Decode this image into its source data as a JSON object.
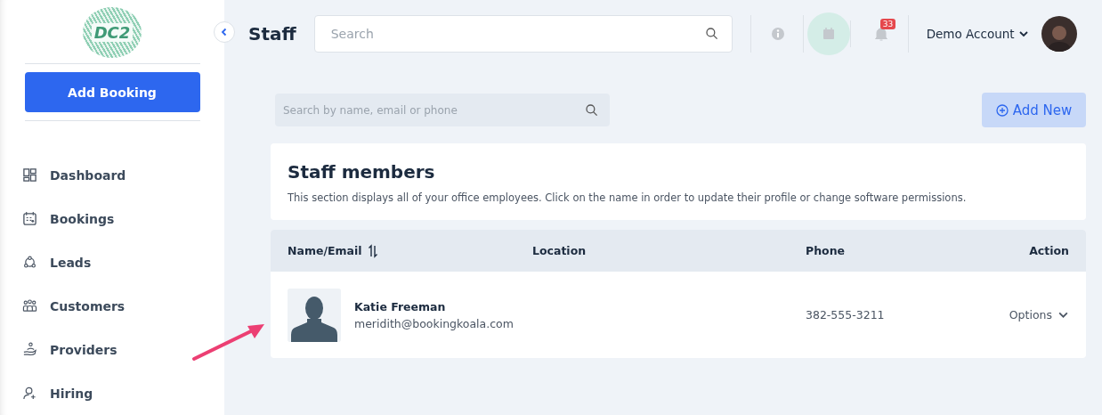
{
  "sidebar": {
    "logo": "DC2",
    "add_button": "Add Booking",
    "items": [
      {
        "label": "Dashboard"
      },
      {
        "label": "Bookings"
      },
      {
        "label": "Leads"
      },
      {
        "label": "Customers"
      },
      {
        "label": "Providers"
      },
      {
        "label": "Hiring"
      }
    ]
  },
  "header": {
    "title": "Staff",
    "search": {
      "placeholder": "Search"
    },
    "notifications": "33",
    "account": "Demo Account"
  },
  "toolbar": {
    "search": {
      "placeholder": "Search by name, email or phone"
    },
    "add_button": "Add New"
  },
  "intro": {
    "title": "Staff members",
    "description": "This section displays all of your office employees. Click on the name in order to update their profile or change software permissions."
  },
  "table": {
    "columns": [
      "Name/Email",
      "Location",
      "Phone",
      "Action"
    ],
    "rows": [
      {
        "name": "Katie Freeman",
        "email": "meridith@bookingkoala.com",
        "phone": "382-555-3211",
        "action": "Options"
      }
    ]
  }
}
